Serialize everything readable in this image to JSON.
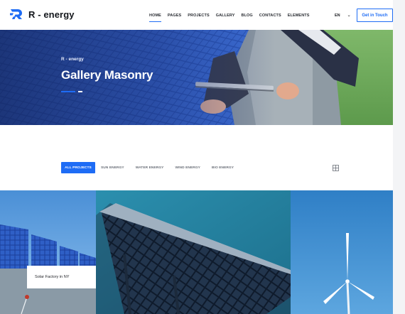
{
  "brand": {
    "name": "R - energy",
    "accent": "#1e6cf5"
  },
  "nav": {
    "items": [
      {
        "label": "HOME",
        "active": true
      },
      {
        "label": "PAGES",
        "active": false
      },
      {
        "label": "PROJECTS",
        "active": false
      },
      {
        "label": "GALLERY",
        "active": false
      },
      {
        "label": "BLOG",
        "active": false
      },
      {
        "label": "CONTACTS",
        "active": false
      },
      {
        "label": "ELEMENTS",
        "active": false
      }
    ],
    "language": "EN",
    "cta_label": "Get in Touch"
  },
  "hero": {
    "subtitle": "R - energy",
    "title": "Gallery Masonry"
  },
  "filters": {
    "items": [
      {
        "label": "ALL PROJECTS",
        "active": true
      },
      {
        "label": "SUN ENERGY",
        "active": false
      },
      {
        "label": "WATER ENERGY",
        "active": false
      },
      {
        "label": "WIND ENERGY",
        "active": false
      },
      {
        "label": "BIO ENERGY",
        "active": false
      }
    ],
    "layout_toggle_icon": "grid-icon"
  },
  "gallery": {
    "items": [
      {
        "caption": "Solar Factory in NY"
      }
    ]
  }
}
